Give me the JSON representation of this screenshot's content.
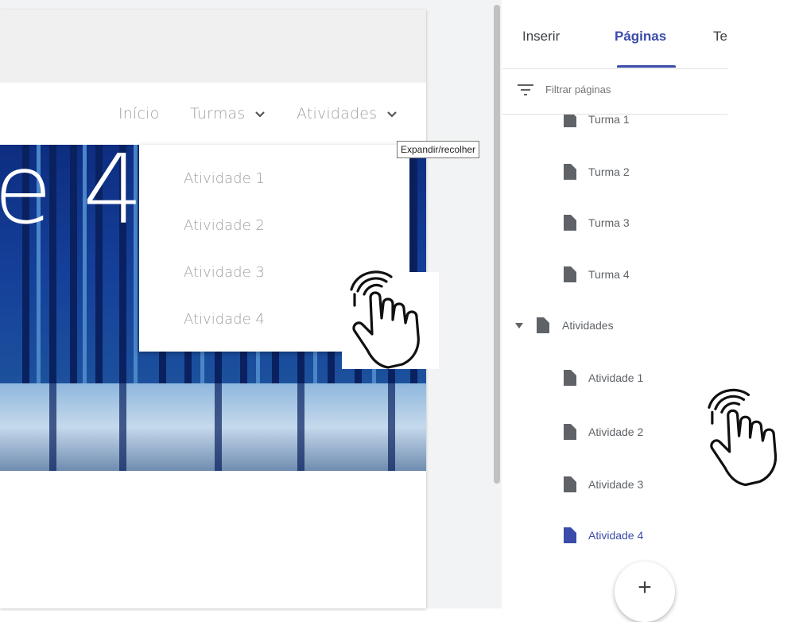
{
  "preview": {
    "nav": {
      "home": "Início",
      "classes": "Turmas",
      "activities": "Atividades"
    },
    "hero_title": "e 4",
    "dropdown": [
      "Atividade 1",
      "Atividade 2",
      "Atividade 3",
      "Atividade 4"
    ],
    "tooltip": "Expandir/recolher"
  },
  "panel": {
    "tabs": {
      "insert": "Inserir",
      "pages": "Páginas",
      "themes": "Te"
    },
    "active_tab": "Páginas",
    "filter": {
      "placeholder": "Filtrar páginas",
      "value": ""
    },
    "pages": [
      {
        "label": "Turma 1",
        "icon": "page-icon"
      },
      {
        "label": "Turma 2",
        "icon": "page-icon"
      },
      {
        "label": "Turma 3",
        "icon": "page-icon"
      },
      {
        "label": "Turma 4",
        "icon": "page-icon"
      },
      {
        "label": "Atividades",
        "icon": "page-icon",
        "expanded": true
      },
      {
        "label": "Atividade 1",
        "icon": "page-icon"
      },
      {
        "label": "Atividade 2",
        "icon": "page-icon"
      },
      {
        "label": "Atividade 3",
        "icon": "page-icon"
      },
      {
        "label": "Atividade 4",
        "icon": "page-icon",
        "selected": true
      }
    ],
    "fab_label": "+"
  },
  "colors": {
    "accent": "#3b4ba9",
    "muted_text": "#5f6368",
    "nav_text": "#9e9e9e",
    "hero_blue": "#15409a"
  }
}
